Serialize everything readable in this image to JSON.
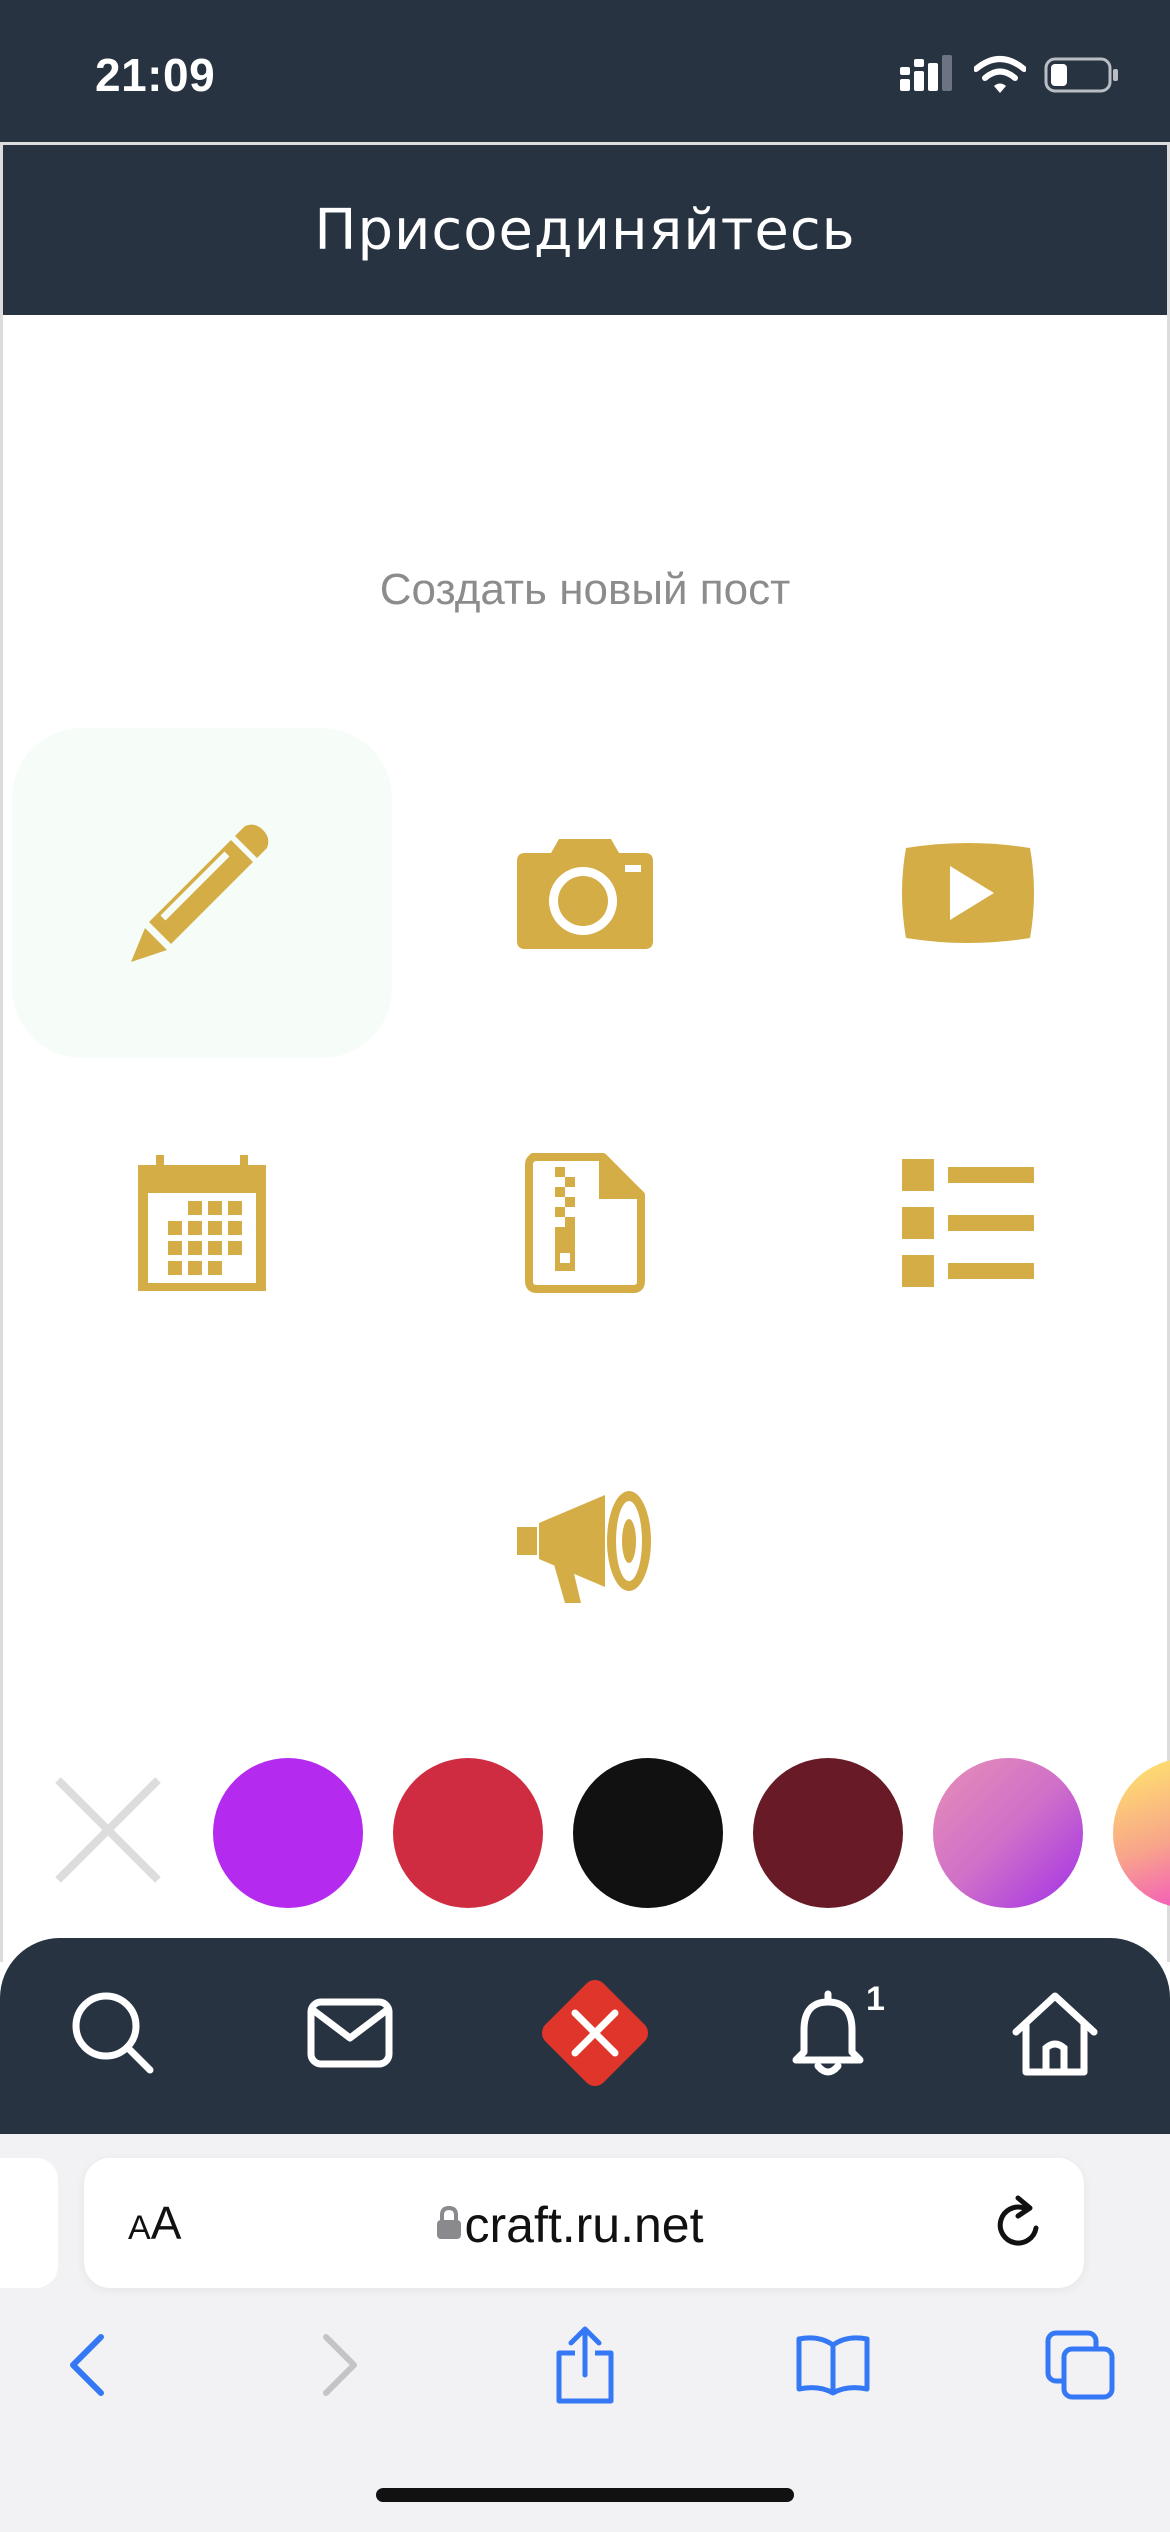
{
  "status_bar": {
    "time": "21:09",
    "battery_level": 0.3
  },
  "header": {
    "title": "Присоединяйтесь"
  },
  "main": {
    "new_post_label": "Создать новый пост"
  },
  "post_types": [
    {
      "icon": "pencil-icon",
      "selected": true
    },
    {
      "icon": "camera-icon",
      "selected": false
    },
    {
      "icon": "video-play-icon",
      "selected": false
    },
    {
      "icon": "calendar-icon",
      "selected": false
    },
    {
      "icon": "zip-file-icon",
      "selected": false
    },
    {
      "icon": "list-icon",
      "selected": false
    },
    {
      "icon": "megaphone-icon",
      "selected": false
    }
  ],
  "colors": {
    "accent": "#d4ad46",
    "nav_background": "#283341",
    "swatches": [
      "#b52aef",
      "#d02c41",
      "#111111",
      "#681b26",
      "gradient-pink-purple",
      "gradient-yellow-pink"
    ]
  },
  "bottom_nav": {
    "items": [
      "search-icon",
      "mail-icon",
      "close-icon",
      "bell-icon",
      "home-icon"
    ],
    "notification_count": "1"
  },
  "browser": {
    "text_size_label": {
      "small": "A",
      "large": "A"
    },
    "url": "craft.ru.net"
  }
}
